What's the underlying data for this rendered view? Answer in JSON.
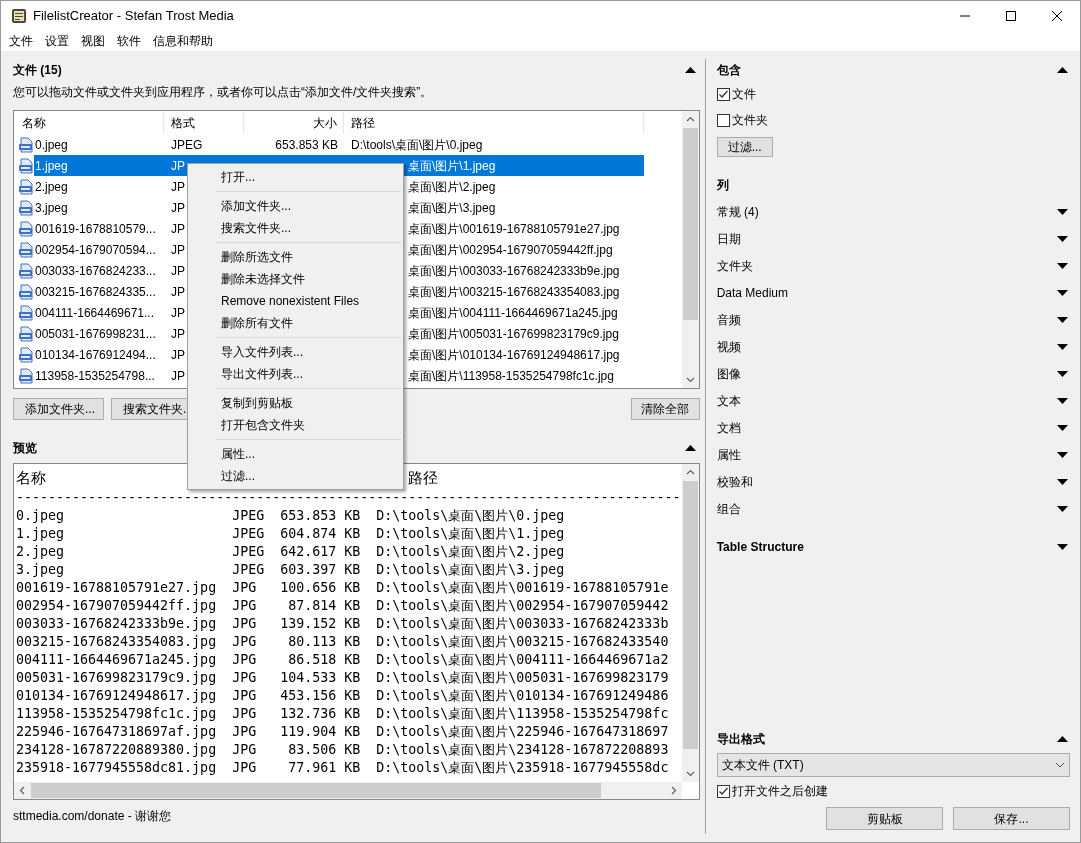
{
  "window": {
    "title": "FilelistCreator - Stefan Trost Media"
  },
  "menu_bar": [
    "文件",
    "设置",
    "视图",
    "软件",
    "信息和帮助"
  ],
  "files_panel": {
    "title": "文件 (15)",
    "expanded": true,
    "hint": "您可以拖动文件或文件夹到应用程序，或者你可以点击“添加文件/文件夹搜索”。",
    "columns": [
      "名称",
      "格式",
      "大小",
      "路径"
    ],
    "rows": [
      {
        "name": "0.jpeg",
        "format": "JPEG",
        "size": "653.853 KB",
        "path": "D:\\tools\\桌面\\图片\\0.jpeg",
        "selected": false
      },
      {
        "name": "1.jpeg",
        "format": "JP",
        "path": "桌面\\图片\\1.jpeg",
        "selected": true
      },
      {
        "name": "2.jpeg",
        "format": "JP",
        "path": "桌面\\图片\\2.jpeg",
        "selected": false
      },
      {
        "name": "3.jpeg",
        "format": "JP",
        "path": "桌面\\图片\\3.jpeg",
        "selected": false
      },
      {
        "name": "001619-1678810579...",
        "format": "JP",
        "path": "桌面\\图片\\001619-16788105791e27.jpg",
        "selected": false
      },
      {
        "name": "002954-1679070594...",
        "format": "JP",
        "path": "桌面\\图片\\002954-167907059442ff.jpg",
        "selected": false
      },
      {
        "name": "003033-1676824233...",
        "format": "JP",
        "path": "桌面\\图片\\003033-16768242333b9e.jpg",
        "selected": false
      },
      {
        "name": "003215-1676824335...",
        "format": "JP",
        "path": "桌面\\图片\\003215-16768243354083.jpg",
        "selected": false
      },
      {
        "name": "004111-1664469671...",
        "format": "JP",
        "path": "桌面\\图片\\004111-1664469671a245.jpg",
        "selected": false
      },
      {
        "name": "005031-1676998231...",
        "format": "JP",
        "path": "桌面\\图片\\005031-167699823179c9.jpg",
        "selected": false
      },
      {
        "name": "010134-1676912494...",
        "format": "JP",
        "path": "桌面\\图片\\010134-16769124948617.jpg",
        "selected": false
      },
      {
        "name": "113958-1535254798...",
        "format": "JP",
        "path": "桌面\\图片\\113958-1535254798fc1c.jpg",
        "selected": false
      }
    ],
    "buttons": [
      "添加文件夹...",
      "搜索文件夹."
    ],
    "clear_button": "清除全部"
  },
  "context_menu": [
    [
      "打开..."
    ],
    [
      "添加文件夹...",
      "搜索文件夹..."
    ],
    [
      "删除所选文件",
      "删除未选择文件",
      "Remove nonexistent Files",
      "删除所有文件"
    ],
    [
      "导入文件列表...",
      "导出文件列表..."
    ],
    [
      "复制到剪贴板",
      "打开包含文件夹"
    ],
    [
      "属性...",
      "过滤..."
    ]
  ],
  "preview": {
    "title": "预览",
    "expanded": true,
    "header": [
      "名称",
      "路径"
    ],
    "separator": "-----------------------------------------------------------------------------------",
    "rows": [
      {
        "name": "0.jpeg",
        "format": "JPEG",
        "size": "653.853 KB",
        "path": "D:\\tools\\桌面\\图片\\0.jpeg"
      },
      {
        "name": "1.jpeg",
        "format": "JPEG",
        "size": "604.874 KB",
        "path": "D:\\tools\\桌面\\图片\\1.jpeg"
      },
      {
        "name": "2.jpeg",
        "format": "JPEG",
        "size": "642.617 KB",
        "path": "D:\\tools\\桌面\\图片\\2.jpeg"
      },
      {
        "name": "3.jpeg",
        "format": "JPEG",
        "size": "603.397 KB",
        "path": "D:\\tools\\桌面\\图片\\3.jpeg"
      },
      {
        "name": "001619-16788105791e27.jpg",
        "format": "JPG",
        "size": "100.656 KB",
        "path": "D:\\tools\\桌面\\图片\\001619-16788105791e"
      },
      {
        "name": "002954-167907059442ff.jpg",
        "format": "JPG",
        "size": "87.814 KB",
        "path": "D:\\tools\\桌面\\图片\\002954-167907059442"
      },
      {
        "name": "003033-16768242333b9e.jpg",
        "format": "JPG",
        "size": "139.152 KB",
        "path": "D:\\tools\\桌面\\图片\\003033-16768242333b"
      },
      {
        "name": "003215-16768243354083.jpg",
        "format": "JPG",
        "size": "80.113 KB",
        "path": "D:\\tools\\桌面\\图片\\003215-167682433540"
      },
      {
        "name": "004111-1664469671a245.jpg",
        "format": "JPG",
        "size": "86.518 KB",
        "path": "D:\\tools\\桌面\\图片\\004111-1664469671a2"
      },
      {
        "name": "005031-167699823179c9.jpg",
        "format": "JPG",
        "size": "104.533 KB",
        "path": "D:\\tools\\桌面\\图片\\005031-167699823179"
      },
      {
        "name": "010134-16769124948617.jpg",
        "format": "JPG",
        "size": "453.156 KB",
        "path": "D:\\tools\\桌面\\图片\\010134-167691249486"
      },
      {
        "name": "113958-1535254798fc1c.jpg",
        "format": "JPG",
        "size": "132.736 KB",
        "path": "D:\\tools\\桌面\\图片\\113958-1535254798fc"
      },
      {
        "name": "225946-167647318697af.jpg",
        "format": "JPG",
        "size": "119.904 KB",
        "path": "D:\\tools\\桌面\\图片\\225946-167647318697"
      },
      {
        "name": "234128-16787220889380.jpg",
        "format": "JPG",
        "size": "83.506 KB",
        "path": "D:\\tools\\桌面\\图片\\234128-167872208893"
      },
      {
        "name": "235918-1677945558dc81.jpg",
        "format": "JPG",
        "size": "77.961 KB",
        "path": "D:\\tools\\桌面\\图片\\235918-1677945558dc"
      }
    ]
  },
  "status": "sttmedia.com/donate - 谢谢您",
  "include": {
    "title": "包含",
    "expanded": true,
    "options": [
      {
        "label": "文件",
        "checked": true
      },
      {
        "label": "文件夹",
        "checked": false
      }
    ],
    "filter_button": "过滤..."
  },
  "columns_section": {
    "title": "列",
    "groups": [
      {
        "label": "常规 (4)",
        "expanded": false
      },
      {
        "label": "日期",
        "expanded": false
      },
      {
        "label": "文件夹",
        "expanded": false
      },
      {
        "label": "Data Medium",
        "expanded": false
      },
      {
        "label": "音频",
        "expanded": false
      },
      {
        "label": "视频",
        "expanded": false
      },
      {
        "label": "图像",
        "expanded": false
      },
      {
        "label": "文本",
        "expanded": false
      },
      {
        "label": "文档",
        "expanded": false
      },
      {
        "label": "属性",
        "expanded": false
      },
      {
        "label": "校验和",
        "expanded": false
      },
      {
        "label": "组合",
        "expanded": false
      }
    ]
  },
  "table_structure": {
    "title": "Table Structure",
    "expanded": false
  },
  "export": {
    "title": "导出格式",
    "expanded": true,
    "format": "文本文件 (TXT)",
    "open_after": {
      "label": "打开文件之后创建",
      "checked": true
    },
    "buttons": [
      "剪贴板",
      "保存..."
    ]
  }
}
